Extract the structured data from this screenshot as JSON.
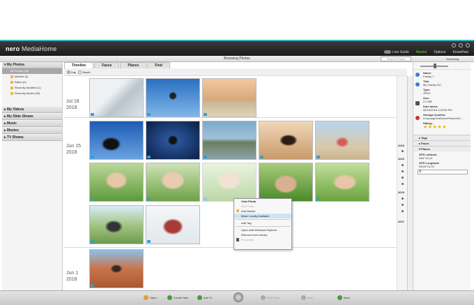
{
  "app": {
    "logo_brand": "nero",
    "logo_product": "MediaHome",
    "topnav": [
      "Live Guide",
      "Market",
      "Options",
      "KnowHow"
    ],
    "browsing_title": "Browsing Photos",
    "search_placeholder": "Search Photos",
    "streaming_label": "Streaming"
  },
  "sidebar": {
    "sections": [
      {
        "label": "My Photos",
        "expanded": true
      },
      {
        "label": "My Videos"
      },
      {
        "label": "My Slide Shows"
      },
      {
        "label": "Music"
      },
      {
        "label": "Movies"
      },
      {
        "label": "TV Shows"
      }
    ],
    "photo_items": [
      "All Photos (39)",
      "Marked (0)",
      "Rated (2)",
      "Recently Modified (1)",
      "Recently Added (39)"
    ]
  },
  "tabs": [
    "Timeline",
    "Faces",
    "Places",
    "Find"
  ],
  "view_mode": {
    "day": "Day",
    "month": "Month",
    "selected": "Day"
  },
  "groups": [
    {
      "date_line1": "Jul 18",
      "date_line2": "2018"
    },
    {
      "date_line1": "Jun 15",
      "date_line2": "2018"
    },
    {
      "date_line1": "Jun 1",
      "date_line2": "2018"
    }
  ],
  "timeline_years": [
    "2018",
    "2016",
    "2015",
    "2007"
  ],
  "context_menu": {
    "items": [
      {
        "label": "View Photo",
        "bold": true
      },
      {
        "label": "Edit Photo",
        "disabled": true
      },
      {
        "label": "Add Marker"
      },
      {
        "label": "Make Locally Available",
        "highlight": true
      },
      {
        "label": "Add Tag"
      },
      {
        "label": "Open with Windows Explorer"
      },
      {
        "label": "Remove from Library"
      },
      {
        "label": "Properties",
        "disabled": true
      }
    ]
  },
  "details": {
    "name_label": "Name:",
    "name": "Family-7",
    "title_label": "Title:",
    "title": "My Family-007",
    "type_label": "Type:",
    "type": "JPEG",
    "size_label": "Size:",
    "size": "2.2 MB",
    "date_label": "Date taken:",
    "date": "06/15/2018 1:03:35 PM",
    "storage_label": "Storage location:",
    "storage": "D:\\anang\\OneDrive\\Pictures\\S...",
    "rating_label": "Rating:",
    "rating": "★★★★★",
    "sections": [
      "Tags",
      "Faces",
      "Places"
    ],
    "gps_lat_label": "GPS Latitude:",
    "gps_lat": "N34°13.24'",
    "gps_lon_label": "GPS Longitude",
    "gps_lon": "W118°13.22'"
  },
  "bottombar": {
    "buttons": [
      {
        "label": "Open",
        "disabled": false
      },
      {
        "label": "Create New",
        "disabled": false
      },
      {
        "label": "Add To",
        "disabled": false
      },
      {
        "label": "Edit Photo",
        "disabled": true
      },
      {
        "label": "Burn",
        "disabled": true
      },
      {
        "label": "More",
        "disabled": false
      }
    ]
  },
  "colors": {
    "accent_teal": "#2fb3c4",
    "market_green": "#6fcf4a",
    "star_gold": "#e8b900",
    "highlight_blue": "#cfe4f7"
  }
}
